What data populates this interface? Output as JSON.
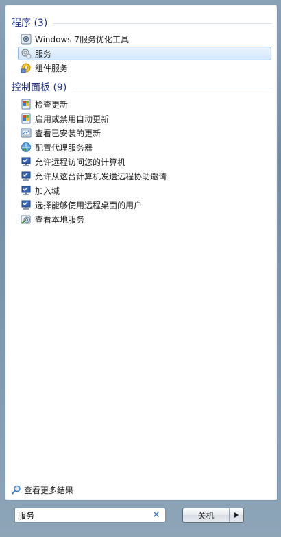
{
  "programs": {
    "header": "程序 (3)",
    "items": [
      {
        "label": "Windows 7服务优化工具",
        "icon": "optimizer-tool-icon"
      },
      {
        "label": "服务",
        "icon": "services-gear-icon",
        "selected": true
      },
      {
        "label": "组件服务",
        "icon": "component-services-icon"
      }
    ]
  },
  "control_panel": {
    "header": "控制面板 (9)",
    "items": [
      {
        "label": "检查更新",
        "icon": "windows-update-icon"
      },
      {
        "label": "启用或禁用自动更新",
        "icon": "windows-update-icon"
      },
      {
        "label": "查看已安装的更新",
        "icon": "installed-updates-icon"
      },
      {
        "label": "配置代理服务器",
        "icon": "internet-options-icon"
      },
      {
        "label": "允许远程访问您的计算机",
        "icon": "system-shield-icon"
      },
      {
        "label": "允许从这台计算机发送远程协助邀请",
        "icon": "system-shield-icon"
      },
      {
        "label": "加入域",
        "icon": "system-shield-icon"
      },
      {
        "label": "选择能够使用远程桌面的用户",
        "icon": "system-shield-icon"
      },
      {
        "label": "查看本地服务",
        "icon": "admin-tools-icon"
      }
    ]
  },
  "more_results": {
    "label": "查看更多结果"
  },
  "search": {
    "value": "服务"
  },
  "shutdown": {
    "label": "关机"
  }
}
